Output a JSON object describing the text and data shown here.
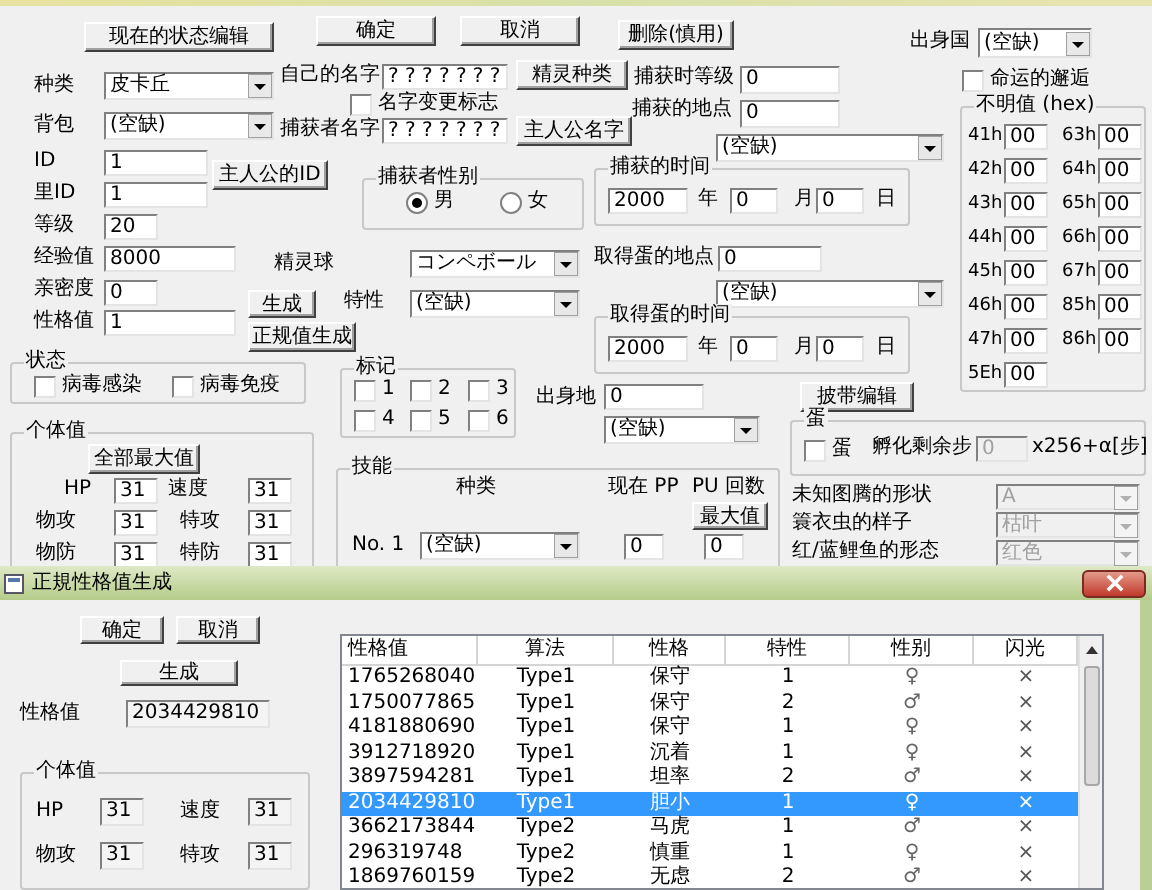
{
  "main_dialog": {
    "controls": [
      {
        "kind": "button",
        "label": "现在的状态编辑"
      },
      {
        "kind": "button",
        "label": "确定"
      },
      {
        "kind": "button",
        "label": "取消"
      },
      {
        "kind": "button",
        "label": "删除(慎用)"
      },
      {
        "kind": "label",
        "text": "出身国"
      },
      {
        "kind": "combo",
        "value": "(空缺)",
        "disabled": false
      },
      {
        "kind": "label",
        "text": "种类"
      },
      {
        "kind": "combo",
        "value": "皮卡丘",
        "disabled": false
      },
      {
        "kind": "label",
        "text": "自己的名字"
      },
      {
        "kind": "field",
        "value": "? ? ? ? ? ? ?",
        "disabled": false
      },
      {
        "kind": "button",
        "label": "精灵种类"
      },
      {
        "kind": "label",
        "text": "捕获时等级"
      },
      {
        "kind": "field",
        "value": "0",
        "disabled": false
      },
      {
        "kind": "checkbox",
        "label": "命运的邂逅",
        "checked": false
      },
      {
        "kind": "checkbox",
        "label": "名字变更标志",
        "checked": false
      },
      {
        "kind": "label",
        "text": "捕获的地点"
      },
      {
        "kind": "field",
        "value": "0",
        "disabled": false
      },
      {
        "kind": "label",
        "text": "背包"
      },
      {
        "kind": "combo",
        "value": "(空缺)",
        "disabled": false
      },
      {
        "kind": "label",
        "text": "捕获者名字"
      },
      {
        "kind": "field",
        "value": "? ? ? ? ? ? ?",
        "disabled": false
      },
      {
        "kind": "button",
        "label": "主人公名字"
      },
      {
        "kind": "combo",
        "value": "(空缺)",
        "disabled": false
      },
      {
        "kind": "label",
        "text": "ID"
      },
      {
        "kind": "field",
        "value": "1",
        "disabled": false
      },
      {
        "kind": "button",
        "label": "主人公的ID"
      },
      {
        "kind": "label",
        "text": "里ID"
      },
      {
        "kind": "field",
        "value": "1",
        "disabled": false
      },
      {
        "kind": "group",
        "title": "捕获者性别"
      },
      {
        "kind": "radio",
        "label": "男",
        "selected": true
      },
      {
        "kind": "radio",
        "label": "女",
        "selected": false
      },
      {
        "kind": "group",
        "title": "捕获的时间"
      },
      {
        "kind": "field",
        "value": "2000",
        "disabled": false
      },
      {
        "kind": "label",
        "text": "年"
      },
      {
        "kind": "field",
        "value": "0",
        "disabled": false
      },
      {
        "kind": "label",
        "text": "月"
      },
      {
        "kind": "field",
        "value": "0",
        "disabled": false
      },
      {
        "kind": "label",
        "text": "日"
      },
      {
        "kind": "label",
        "text": "等级"
      },
      {
        "kind": "field",
        "value": "20",
        "disabled": false
      },
      {
        "kind": "label",
        "text": "经验值"
      },
      {
        "kind": "field",
        "value": "8000",
        "disabled": false
      },
      {
        "kind": "label",
        "text": "精灵球"
      },
      {
        "kind": "combo",
        "value": "コンペボール",
        "disabled": false
      },
      {
        "kind": "label",
        "text": "取得蛋的地点"
      },
      {
        "kind": "field",
        "value": "0",
        "disabled": false
      },
      {
        "kind": "label",
        "text": "亲密度"
      },
      {
        "kind": "field",
        "value": "0",
        "disabled": false
      },
      {
        "kind": "button",
        "label": "生成"
      },
      {
        "kind": "label",
        "text": "特性"
      },
      {
        "kind": "combo",
        "value": "(空缺)",
        "disabled": false
      },
      {
        "kind": "combo",
        "value": "(空缺)",
        "disabled": false
      },
      {
        "kind": "label",
        "text": "性格值"
      },
      {
        "kind": "field",
        "value": "1",
        "disabled": false
      },
      {
        "kind": "button",
        "label": "正规值生成"
      },
      {
        "kind": "group",
        "title": "取得蛋的时间"
      },
      {
        "kind": "field",
        "value": "2000",
        "disabled": false
      },
      {
        "kind": "label",
        "text": "年"
      },
      {
        "kind": "field",
        "value": "0",
        "disabled": false
      },
      {
        "kind": "label",
        "text": "月"
      },
      {
        "kind": "field",
        "value": "0",
        "disabled": false
      },
      {
        "kind": "label",
        "text": "日"
      },
      {
        "kind": "group",
        "title": "状态"
      },
      {
        "kind": "checkbox",
        "label": "病毒感染",
        "checked": false
      },
      {
        "kind": "checkbox",
        "label": "病毒免疫",
        "checked": false
      },
      {
        "kind": "group",
        "title": "标记"
      },
      {
        "kind": "checkbox",
        "label": "1",
        "checked": false
      },
      {
        "kind": "checkbox",
        "label": "2",
        "checked": false
      },
      {
        "kind": "checkbox",
        "label": "3",
        "checked": false
      },
      {
        "kind": "checkbox",
        "label": "4",
        "checked": false
      },
      {
        "kind": "checkbox",
        "label": "5",
        "checked": false
      },
      {
        "kind": "checkbox",
        "label": "6",
        "checked": false
      },
      {
        "kind": "label",
        "text": "出身地"
      },
      {
        "kind": "field",
        "value": "0",
        "disabled": false
      },
      {
        "kind": "button",
        "label": "披带编辑"
      },
      {
        "kind": "combo",
        "value": "(空缺)",
        "disabled": false
      },
      {
        "kind": "group",
        "title": "蛋"
      },
      {
        "kind": "checkbox",
        "label": "蛋",
        "checked": false
      },
      {
        "kind": "label",
        "text": "孵化剩余步"
      },
      {
        "kind": "field",
        "value": "0",
        "disabled": true
      },
      {
        "kind": "label",
        "text": "x256+α[步]"
      },
      {
        "kind": "group",
        "title": "个体值"
      },
      {
        "kind": "button",
        "label": "全部最大值"
      },
      {
        "kind": "label",
        "text": "HP"
      },
      {
        "kind": "field",
        "value": "31",
        "disabled": false
      },
      {
        "kind": "label",
        "text": "速度"
      },
      {
        "kind": "field",
        "value": "31",
        "disabled": false
      },
      {
        "kind": "label",
        "text": "物攻"
      },
      {
        "kind": "field",
        "value": "31",
        "disabled": false
      },
      {
        "kind": "label",
        "text": "特攻"
      },
      {
        "kind": "field",
        "value": "31",
        "disabled": false
      },
      {
        "kind": "label",
        "text": "物防"
      },
      {
        "kind": "field",
        "value": "31",
        "disabled": false
      },
      {
        "kind": "label",
        "text": "特防"
      },
      {
        "kind": "field",
        "value": "31",
        "disabled": false
      },
      {
        "kind": "group",
        "title": "技能"
      },
      {
        "kind": "label",
        "text": "种类"
      },
      {
        "kind": "label",
        "text": "现在 PP"
      },
      {
        "kind": "label",
        "text": "PU 回数"
      },
      {
        "kind": "button",
        "label": "最大值"
      },
      {
        "kind": "label",
        "text": "No. 1"
      },
      {
        "kind": "combo",
        "value": "(空缺)",
        "disabled": false
      },
      {
        "kind": "field",
        "value": "0",
        "disabled": false
      },
      {
        "kind": "field",
        "value": "0",
        "disabled": false
      },
      {
        "kind": "label",
        "text": "未知图腾的形状"
      },
      {
        "kind": "combo",
        "value": "A",
        "disabled": true
      },
      {
        "kind": "label",
        "text": "簑衣虫的样子"
      },
      {
        "kind": "combo",
        "value": "枯叶",
        "disabled": true
      },
      {
        "kind": "label",
        "text": "红/蓝鲤鱼的形态"
      },
      {
        "kind": "combo",
        "value": "红色",
        "disabled": true
      }
    ],
    "unknown_values": {
      "title": "不明值 (hex)",
      "items": [
        {
          "label": "41h",
          "value": "00"
        },
        {
          "label": "63h",
          "value": "00"
        },
        {
          "label": "42h",
          "value": "00"
        },
        {
          "label": "64h",
          "value": "00"
        },
        {
          "label": "43h",
          "value": "00"
        },
        {
          "label": "65h",
          "value": "00"
        },
        {
          "label": "44h",
          "value": "00"
        },
        {
          "label": "66h",
          "value": "00"
        },
        {
          "label": "45h",
          "value": "00"
        },
        {
          "label": "67h",
          "value": "00"
        },
        {
          "label": "46h",
          "value": "00"
        },
        {
          "label": "85h",
          "value": "00"
        },
        {
          "label": "47h",
          "value": "00"
        },
        {
          "label": "86h",
          "value": "00"
        },
        {
          "label": "5Eh",
          "value": "00"
        }
      ]
    }
  },
  "generator_dialog": {
    "title": "正規性格值生成",
    "buttons": [
      "确定",
      "取消"
    ],
    "generate_button": "生成",
    "personality": {
      "label": "性格值",
      "value": "2034429810"
    },
    "ivs": {
      "title": "个体值",
      "items": [
        {
          "label": "HP",
          "value": "31"
        },
        {
          "label": "速度",
          "value": "31"
        },
        {
          "label": "物攻",
          "value": "31"
        },
        {
          "label": "特攻",
          "value": "31"
        }
      ]
    },
    "table": {
      "columns": [
        "性格值",
        "算法",
        "性格",
        "特性",
        "性别",
        "闪光"
      ],
      "rows": [
        {
          "cells": [
            "1765268040",
            "Type1",
            "保守",
            "1",
            "♀",
            "×"
          ],
          "selected": false
        },
        {
          "cells": [
            "1750077865",
            "Type1",
            "保守",
            "2",
            "♂",
            "×"
          ],
          "selected": false
        },
        {
          "cells": [
            "4181880690",
            "Type1",
            "保守",
            "1",
            "♀",
            "×"
          ],
          "selected": false
        },
        {
          "cells": [
            "3912718920",
            "Type1",
            "沉着",
            "1",
            "♀",
            "×"
          ],
          "selected": false
        },
        {
          "cells": [
            "3897594281",
            "Type1",
            "坦率",
            "2",
            "♂",
            "×"
          ],
          "selected": false
        },
        {
          "cells": [
            "2034429810",
            "Type1",
            "胆小",
            "1",
            "♀",
            "×"
          ],
          "selected": true
        },
        {
          "cells": [
            "3662173844",
            "Type2",
            "马虎",
            "1",
            "♂",
            "×"
          ],
          "selected": false
        },
        {
          "cells": [
            "296319748",
            "Type2",
            "慎重",
            "1",
            "♀",
            "×"
          ],
          "selected": false
        },
        {
          "cells": [
            "1869760159",
            "Type2",
            "无虑",
            "2",
            "♂",
            "×"
          ],
          "selected": false
        }
      ]
    }
  }
}
